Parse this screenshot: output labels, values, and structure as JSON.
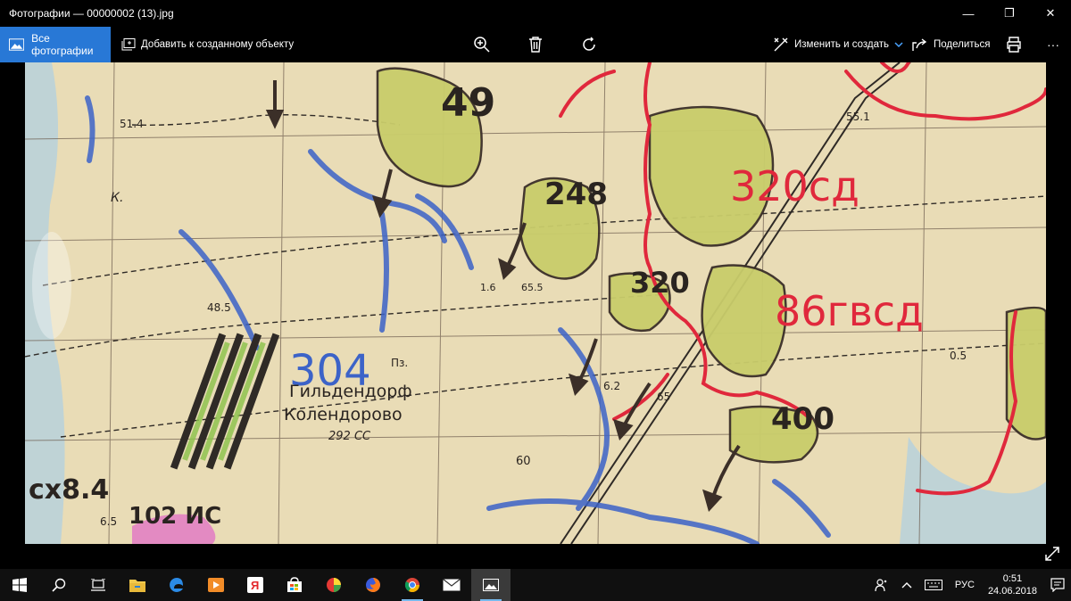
{
  "window": {
    "title": "Фотографии — 00000002 (13).jpg",
    "minimize": "—",
    "maximize": "❐",
    "close": "✕"
  },
  "toolbar": {
    "all_photos": "Все фотографии",
    "add_to_creation": "Добавить к созданному объекту",
    "edit_create": "Изменить и создать",
    "share": "Поделиться",
    "more": "···"
  },
  "map": {
    "labels": {
      "n49": "49",
      "n248": "248",
      "n320": "320",
      "n320sd": "320сд",
      "n86gvsd": "86гвсд",
      "n304": "304",
      "n400": "400",
      "n514": "51.4",
      "n485": "48.5",
      "n551": "55.1",
      "n16": "1.6",
      "n655": "65.5",
      "n62": "6.2",
      "n65": "65",
      "n60": "60",
      "n65b": "6.5",
      "k": "К.",
      "gildendorf": "Гильдендорф",
      "kolendorovo": "Колендорово",
      "n292cc": "292 СС",
      "pz": "Пз.",
      "sx84": "сх8.4",
      "n102": "102 ИС",
      "n05": "0.5"
    },
    "colors": {
      "paper": "#e9dcb6",
      "forest": "#c9cd6b",
      "blue": "#3c63c8",
      "red": "#e0283c",
      "brown": "#3b2f28"
    }
  },
  "taskbar": {
    "lang": "РУС",
    "time": "0:51",
    "date": "24.06.2018"
  }
}
